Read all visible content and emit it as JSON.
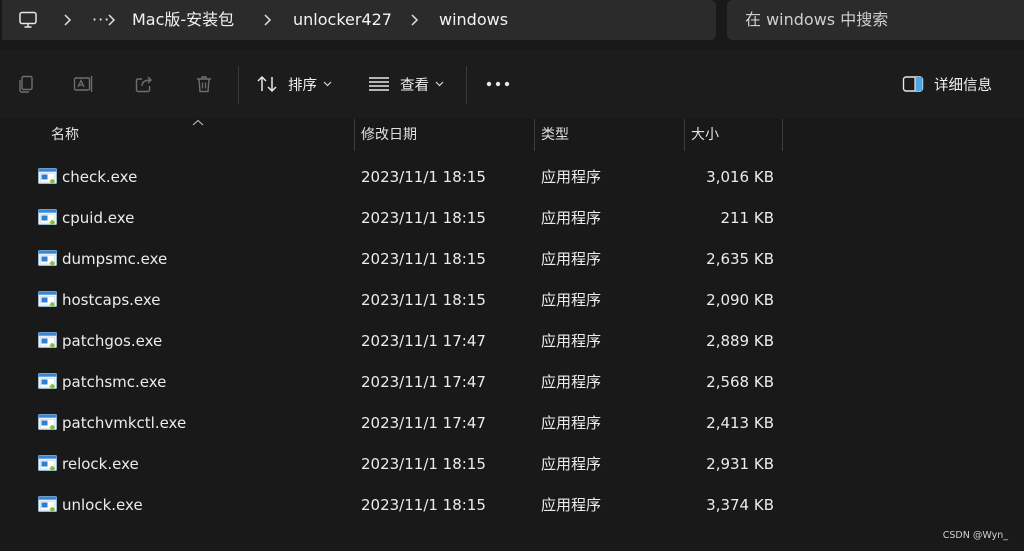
{
  "address_bar": {
    "more": "···",
    "breadcrumbs": [
      "Mac版-安装包",
      "unlocker427",
      "windows"
    ]
  },
  "search": {
    "placeholder": "在 windows 中搜索"
  },
  "toolbar": {
    "sort_label": "排序",
    "view_label": "查看",
    "details_label": "详细信息"
  },
  "columns": {
    "name": "名称",
    "date": "修改日期",
    "type": "类型",
    "size": "大小"
  },
  "files": [
    {
      "name": "check.exe",
      "date": "2023/11/1 18:15",
      "type": "应用程序",
      "size": "3,016 KB"
    },
    {
      "name": "cpuid.exe",
      "date": "2023/11/1 18:15",
      "type": "应用程序",
      "size": "211 KB"
    },
    {
      "name": "dumpsmc.exe",
      "date": "2023/11/1 18:15",
      "type": "应用程序",
      "size": "2,635 KB"
    },
    {
      "name": "hostcaps.exe",
      "date": "2023/11/1 18:15",
      "type": "应用程序",
      "size": "2,090 KB"
    },
    {
      "name": "patchgos.exe",
      "date": "2023/11/1 17:47",
      "type": "应用程序",
      "size": "2,889 KB"
    },
    {
      "name": "patchsmc.exe",
      "date": "2023/11/1 17:47",
      "type": "应用程序",
      "size": "2,568 KB"
    },
    {
      "name": "patchvmkctl.exe",
      "date": "2023/11/1 17:47",
      "type": "应用程序",
      "size": "2,413 KB"
    },
    {
      "name": "relock.exe",
      "date": "2023/11/1 18:15",
      "type": "应用程序",
      "size": "2,931 KB"
    },
    {
      "name": "unlock.exe",
      "date": "2023/11/1 18:15",
      "type": "应用程序",
      "size": "3,374 KB"
    }
  ],
  "watermark": "CSDN @Wyn_",
  "icons": {
    "computer": "computer-icon",
    "copy": "copy-icon",
    "rename": "rename-icon",
    "share": "share-icon",
    "delete": "trash-icon",
    "sort": "sort-icon",
    "view": "view-icon",
    "more": "more-icon",
    "details": "details-pane-icon",
    "file": "exe-file-icon"
  },
  "colors": {
    "background": "#191919",
    "bar": "#2b2b2b",
    "text": "#e8e8e8"
  }
}
